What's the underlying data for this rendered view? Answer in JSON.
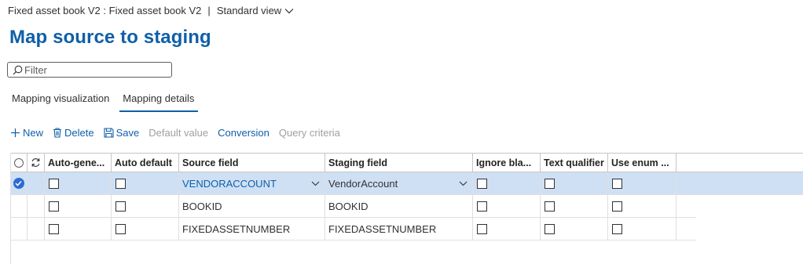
{
  "breadcrumb": {
    "entity": "Fixed asset book V2 : Fixed asset book V2",
    "separator": "|",
    "view": "Standard view"
  },
  "title": "Map source to staging",
  "filter": {
    "placeholder": "Filter"
  },
  "tabs": [
    {
      "label": "Mapping visualization",
      "active": false
    },
    {
      "label": "Mapping details",
      "active": true
    }
  ],
  "toolbar": {
    "new": "New",
    "delete": "Delete",
    "save": "Save",
    "default_value": "Default value",
    "conversion": "Conversion",
    "query_criteria": "Query criteria"
  },
  "grid": {
    "columns": {
      "auto_generated": "Auto-gene...",
      "auto_default": "Auto default",
      "source_field": "Source field",
      "staging_field": "Staging field",
      "ignore_blank": "Ignore bla...",
      "text_qualifier": "Text qualifier",
      "use_enum": "Use enum ..."
    },
    "rows": [
      {
        "source": "VENDORACCOUNT",
        "staging": "VendorAccount",
        "selected": true
      },
      {
        "source": "BOOKID",
        "staging": "BOOKID",
        "selected": false
      },
      {
        "source": "FIXEDASSETNUMBER",
        "staging": "FIXEDASSETNUMBER",
        "selected": false
      }
    ]
  },
  "colors": {
    "accent": "#0f5fa8",
    "selected_row": "#cfe0f5",
    "disabled": "#a19f9d"
  }
}
